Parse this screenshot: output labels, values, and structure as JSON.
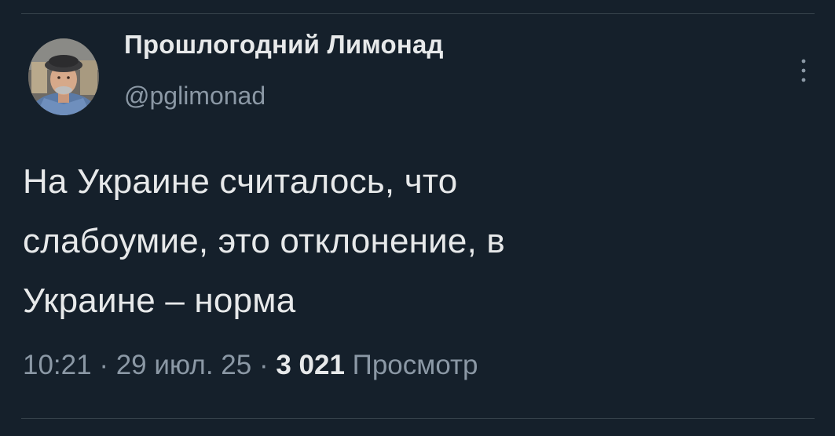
{
  "tweet": {
    "display_name": "Прошлогодний Лимонад",
    "handle": "@pglimonad",
    "text_lines": [
      "На Украине считалось, что",
      "слабоумие, это отклонение, в",
      "Украине – норма"
    ],
    "time": "10:21",
    "separator": "·",
    "date": "29 июл. 25",
    "views_count": "3 021",
    "views_label": "Просмотр",
    "avatar_icon": "user-avatar-photo",
    "more_icon": "more-options-vertical-icon"
  },
  "colors": {
    "background": "#15202b",
    "primary_text": "#e7e9ea",
    "secondary_text": "#8b98a5",
    "divider": "#38444d"
  }
}
